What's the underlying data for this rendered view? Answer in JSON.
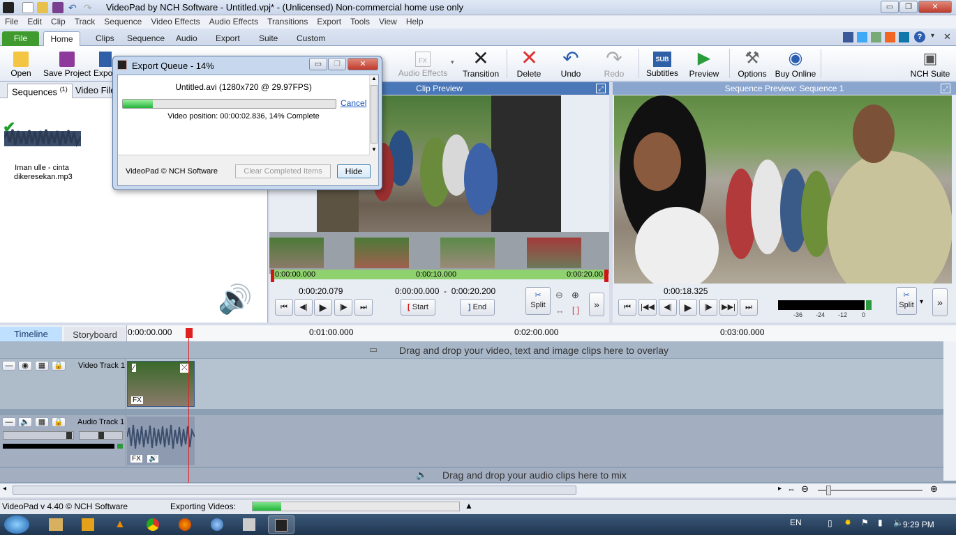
{
  "titlebar": {
    "title": "VideoPad by NCH Software - Untitled.vpj* - (Unlicensed) Non-commercial home use only",
    "min": "▭",
    "max": "❐",
    "close": "✕"
  },
  "menu": [
    "File",
    "Edit",
    "Clip",
    "Track",
    "Sequence",
    "Video Effects",
    "Audio Effects",
    "Transitions",
    "Export",
    "Tools",
    "View",
    "Help"
  ],
  "tabs": [
    "File",
    "Home",
    "Clips",
    "Sequence",
    "Audio",
    "Export",
    "Suite",
    "Custom"
  ],
  "toolbar": {
    "open": "Open",
    "save_project": "Save Project",
    "export": "Expo",
    "audio_effects": "Audio Effects",
    "transition": "Transition",
    "delete": "Delete",
    "undo": "Undo",
    "redo": "Redo",
    "subtitles": "Subtitles",
    "preview": "Preview",
    "options": "Options",
    "buy_online": "Buy Online",
    "nch_suite": "NCH Suite",
    "sub_icon": "SUB",
    "fx_icon": "FX"
  },
  "bin": {
    "tab_sequences": "Sequences",
    "tab_sequences_count": "(1)",
    "tab_video_files": "Video File",
    "clip_name_line1": "Iman ulle - cinta",
    "clip_name_line2": "dikeresekan.mp3"
  },
  "clip_preview": {
    "header": "Clip Preview",
    "scrub_start": "0:00:00.000",
    "scrub_mid": "0:00:10.000",
    "scrub_end": "0:00:20.00",
    "current_time": "0:00:20.079",
    "range": "0:00:00.000  -  0:00:20.200",
    "start_label": "Start",
    "end_label": "End",
    "split_label": "Split"
  },
  "sequence_preview": {
    "header": "Sequence Preview: Sequence 1",
    "current_time": "0:00:18.325",
    "split_label": "Split",
    "meter_labels": [
      "-36",
      "-24",
      "-12",
      "0"
    ]
  },
  "timeline": {
    "tab_timeline": "Timeline",
    "tab_storyboard": "Storyboard",
    "ruler": [
      "0:00:00.000",
      "0:01:00.000",
      "0:02:00.000",
      "0:03:00.000"
    ],
    "overlay_hint": "Drag and drop your video, text and image clips here to overlay",
    "video_track": "Video Track 1",
    "audio_track": "Audio Track 1",
    "audio_hint": "Drag and drop your audio clips here to mix",
    "fx": "FX"
  },
  "status": {
    "version": "VideoPad v 4.40 © NCH Software",
    "exporting": "Exporting Videos:",
    "export_progress": 0.14
  },
  "dialog": {
    "title": "Export Queue - 14%",
    "file": "Untitled.avi (1280x720 @ 29.97FPS)",
    "cancel": "Cancel",
    "position": "Video position:  00:00:02.836, 14% Complete",
    "progress": 0.14,
    "copyright": "VideoPad © NCH Software",
    "clear": "Clear Completed Items",
    "hide": "Hide"
  },
  "taskbar": {
    "lang": "EN",
    "time": "9:29 PM"
  },
  "colors": {
    "accent": "#4a77b7",
    "file_tab": "#3f9b2e",
    "progress": "#2ecc40",
    "playhead": "#e02020"
  }
}
